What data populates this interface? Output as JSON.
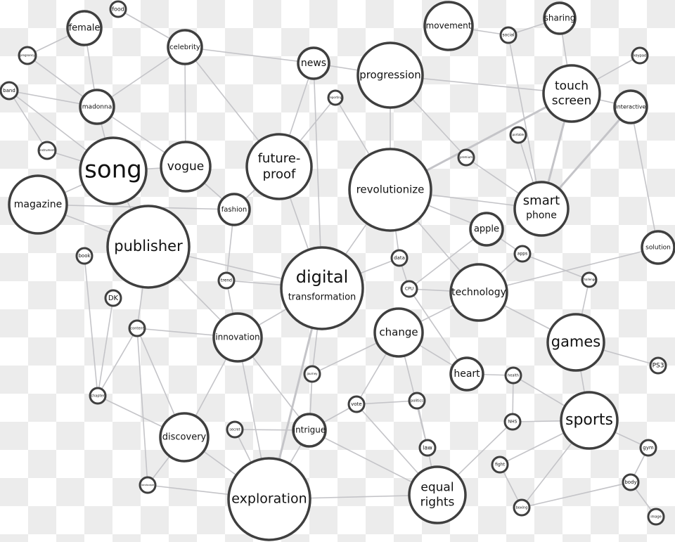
{
  "diagram": {
    "type": "concept-network",
    "colors": {
      "node_stroke": "#3f3f3f",
      "edge": "#c4c4c8",
      "text": "#111111"
    },
    "nodes": [
      {
        "id": "food",
        "label": [
          "food"
        ]
      },
      {
        "id": "female",
        "label": [
          "female"
        ]
      },
      {
        "id": "pregnancy",
        "label": [
          "pregnancy"
        ]
      },
      {
        "id": "band",
        "label": [
          "band"
        ]
      },
      {
        "id": "madonna",
        "label": [
          "madonna"
        ]
      },
      {
        "id": "celebrity",
        "label": [
          "celebrity"
        ]
      },
      {
        "id": "instrument",
        "label": [
          "instrument"
        ]
      },
      {
        "id": "song",
        "label": [
          "song"
        ]
      },
      {
        "id": "vogue",
        "label": [
          "vogue"
        ]
      },
      {
        "id": "magazine",
        "label": [
          "magazine"
        ]
      },
      {
        "id": "publisher",
        "label": [
          "publisher"
        ]
      },
      {
        "id": "fashion",
        "label": [
          "fashion"
        ]
      },
      {
        "id": "future-proof",
        "label": [
          "future-",
          "proof"
        ]
      },
      {
        "id": "news",
        "label": [
          "news"
        ]
      },
      {
        "id": "reporting",
        "label": [
          "reporting"
        ]
      },
      {
        "id": "progression",
        "label": [
          "progression"
        ]
      },
      {
        "id": "movement",
        "label": [
          "movement"
        ]
      },
      {
        "id": "social",
        "label": [
          "social"
        ]
      },
      {
        "id": "sharing",
        "label": [
          "sharing"
        ]
      },
      {
        "id": "keypad",
        "label": [
          "keypad"
        ]
      },
      {
        "id": "touch-screen",
        "label": [
          "touch",
          "screen"
        ]
      },
      {
        "id": "interactive",
        "label": [
          "interactive"
        ]
      },
      {
        "id": "portable",
        "label": [
          "portable"
        ]
      },
      {
        "id": "premium",
        "label": [
          "premium"
        ]
      },
      {
        "id": "revolutionize",
        "label": [
          "revolutionize"
        ]
      },
      {
        "id": "smart-phone",
        "label": [
          "smart",
          "phone"
        ]
      },
      {
        "id": "apple",
        "label": [
          "apple"
        ]
      },
      {
        "id": "solution",
        "label": [
          "solution"
        ]
      },
      {
        "id": "apps",
        "label": [
          "apps"
        ]
      },
      {
        "id": "data",
        "label": [
          "data"
        ]
      },
      {
        "id": "challenge",
        "label": [
          "challenge"
        ]
      },
      {
        "id": "book",
        "label": [
          "book"
        ]
      },
      {
        "id": "dk",
        "label": [
          "DK"
        ]
      },
      {
        "id": "trend",
        "label": [
          "trend"
        ]
      },
      {
        "id": "digital-transformation",
        "label": [
          "digital",
          "transformation"
        ]
      },
      {
        "id": "cpu",
        "label": [
          "CPU"
        ]
      },
      {
        "id": "technology",
        "label": [
          "technology"
        ]
      },
      {
        "id": "content",
        "label": [
          "content"
        ]
      },
      {
        "id": "innovation",
        "label": [
          "innovation"
        ]
      },
      {
        "id": "change",
        "label": [
          "change"
        ]
      },
      {
        "id": "games",
        "label": [
          "games"
        ]
      },
      {
        "id": "ps3",
        "label": [
          "PS3"
        ]
      },
      {
        "id": "journey",
        "label": [
          "journey"
        ]
      },
      {
        "id": "heart",
        "label": [
          "heart"
        ]
      },
      {
        "id": "health",
        "label": [
          "health"
        ]
      },
      {
        "id": "chapter",
        "label": [
          "chapter"
        ]
      },
      {
        "id": "vote",
        "label": [
          "vote"
        ]
      },
      {
        "id": "politics",
        "label": [
          "politics"
        ]
      },
      {
        "id": "nhs",
        "label": [
          "NHS"
        ]
      },
      {
        "id": "sports",
        "label": [
          "sports"
        ]
      },
      {
        "id": "discovery",
        "label": [
          "discovery"
        ]
      },
      {
        "id": "secret",
        "label": [
          "secret"
        ]
      },
      {
        "id": "intrigue",
        "label": [
          "intrigue"
        ]
      },
      {
        "id": "law",
        "label": [
          "law"
        ]
      },
      {
        "id": "gym",
        "label": [
          "gym"
        ]
      },
      {
        "id": "fight",
        "label": [
          "fight"
        ]
      },
      {
        "id": "equal-rights",
        "label": [
          "equal",
          "rights"
        ]
      },
      {
        "id": "exploration",
        "label": [
          "exploration"
        ]
      },
      {
        "id": "landscape",
        "label": [
          "landscape"
        ]
      },
      {
        "id": "body",
        "label": [
          "body"
        ]
      },
      {
        "id": "boxing",
        "label": [
          "boxing"
        ]
      },
      {
        "id": "image",
        "label": [
          "image"
        ]
      }
    ],
    "edges": [
      [
        "food",
        "celebrity"
      ],
      [
        "female",
        "madonna"
      ],
      [
        "female",
        "pregnancy"
      ],
      [
        "pregnancy",
        "madonna"
      ],
      [
        "band",
        "madonna"
      ],
      [
        "band",
        "song"
      ],
      [
        "band",
        "instrument"
      ],
      [
        "instrument",
        "song"
      ],
      [
        "madonna",
        "celebrity"
      ],
      [
        "madonna",
        "song"
      ],
      [
        "madonna",
        "vogue"
      ],
      [
        "celebrity",
        "vogue"
      ],
      [
        "celebrity",
        "news"
      ],
      [
        "celebrity",
        "future-proof"
      ],
      [
        "song",
        "vogue"
      ],
      [
        "song",
        "magazine"
      ],
      [
        "song",
        "publisher"
      ],
      [
        "vogue",
        "fashion"
      ],
      [
        "magazine",
        "publisher"
      ],
      [
        "magazine",
        "fashion"
      ],
      [
        "publisher",
        "digital-transformation"
      ],
      [
        "publisher",
        "innovation"
      ],
      [
        "publisher",
        "content"
      ],
      [
        "fashion",
        "future-proof"
      ],
      [
        "fashion",
        "trend"
      ],
      [
        "future-proof",
        "news"
      ],
      [
        "future-proof",
        "reporting"
      ],
      [
        "future-proof",
        "digital-transformation"
      ],
      [
        "news",
        "digital-transformation"
      ],
      [
        "news",
        "progression"
      ],
      [
        "reporting",
        "revolutionize"
      ],
      [
        "progression",
        "revolutionize"
      ],
      [
        "progression",
        "touch-screen"
      ],
      [
        "progression",
        "premium"
      ],
      [
        "movement",
        "social"
      ],
      [
        "social",
        "sharing"
      ],
      [
        "social",
        "smart-phone"
      ],
      [
        "sharing",
        "touch-screen"
      ],
      [
        "keypad",
        "touch-screen"
      ],
      [
        "touch-screen",
        "interactive"
      ],
      [
        "touch-screen",
        "smart-phone"
      ],
      [
        "touch-screen",
        "revolutionize"
      ],
      [
        "interactive",
        "smart-phone"
      ],
      [
        "interactive",
        "solution"
      ],
      [
        "portable",
        "smart-phone"
      ],
      [
        "premium",
        "smart-phone"
      ],
      [
        "revolutionize",
        "smart-phone"
      ],
      [
        "revolutionize",
        "apple"
      ],
      [
        "revolutionize",
        "technology"
      ],
      [
        "revolutionize",
        "digital-transformation"
      ],
      [
        "revolutionize",
        "data"
      ],
      [
        "data",
        "cpu"
      ],
      [
        "data",
        "digital-transformation"
      ],
      [
        "apple",
        "apps"
      ],
      [
        "apple",
        "cpu"
      ],
      [
        "apps",
        "technology"
      ],
      [
        "apps",
        "challenge"
      ],
      [
        "technology",
        "solution"
      ],
      [
        "technology",
        "change"
      ],
      [
        "technology",
        "cpu"
      ],
      [
        "technology",
        "games"
      ],
      [
        "challenge",
        "games"
      ],
      [
        "games",
        "ps3"
      ],
      [
        "games",
        "sports"
      ],
      [
        "cpu",
        "heart"
      ],
      [
        "heart",
        "health"
      ],
      [
        "health",
        "sports"
      ],
      [
        "health",
        "nhs"
      ],
      [
        "nhs",
        "sports"
      ],
      [
        "nhs",
        "equal-rights"
      ],
      [
        "sports",
        "gym"
      ],
      [
        "sports",
        "fight"
      ],
      [
        "sports",
        "boxing"
      ],
      [
        "gym",
        "body"
      ],
      [
        "body",
        "boxing"
      ],
      [
        "body",
        "image"
      ],
      [
        "fight",
        "boxing"
      ],
      [
        "book",
        "chapter"
      ],
      [
        "dk",
        "chapter"
      ],
      [
        "content",
        "chapter"
      ],
      [
        "content",
        "discovery"
      ],
      [
        "content",
        "landscape"
      ],
      [
        "content",
        "innovation"
      ],
      [
        "chapter",
        "discovery"
      ],
      [
        "trend",
        "innovation"
      ],
      [
        "trend",
        "digital-transformation"
      ],
      [
        "innovation",
        "digital-transformation"
      ],
      [
        "innovation",
        "discovery"
      ],
      [
        "innovation",
        "exploration"
      ],
      [
        "innovation",
        "intrigue"
      ],
      [
        "digital-transformation",
        "journey"
      ],
      [
        "digital-transformation",
        "exploration"
      ],
      [
        "change",
        "journey"
      ],
      [
        "change",
        "vote"
      ],
      [
        "change",
        "law"
      ],
      [
        "change",
        "heart"
      ],
      [
        "journey",
        "intrigue"
      ],
      [
        "vote",
        "politics"
      ],
      [
        "vote",
        "intrigue"
      ],
      [
        "vote",
        "equal-rights"
      ],
      [
        "politics",
        "law"
      ],
      [
        "intrigue",
        "secret"
      ],
      [
        "intrigue",
        "exploration"
      ],
      [
        "intrigue",
        "equal-rights"
      ],
      [
        "law",
        "equal-rights"
      ],
      [
        "secret",
        "exploration"
      ],
      [
        "discovery",
        "exploration"
      ],
      [
        "discovery",
        "landscape"
      ],
      [
        "landscape",
        "exploration"
      ],
      [
        "exploration",
        "equal-rights"
      ]
    ]
  }
}
